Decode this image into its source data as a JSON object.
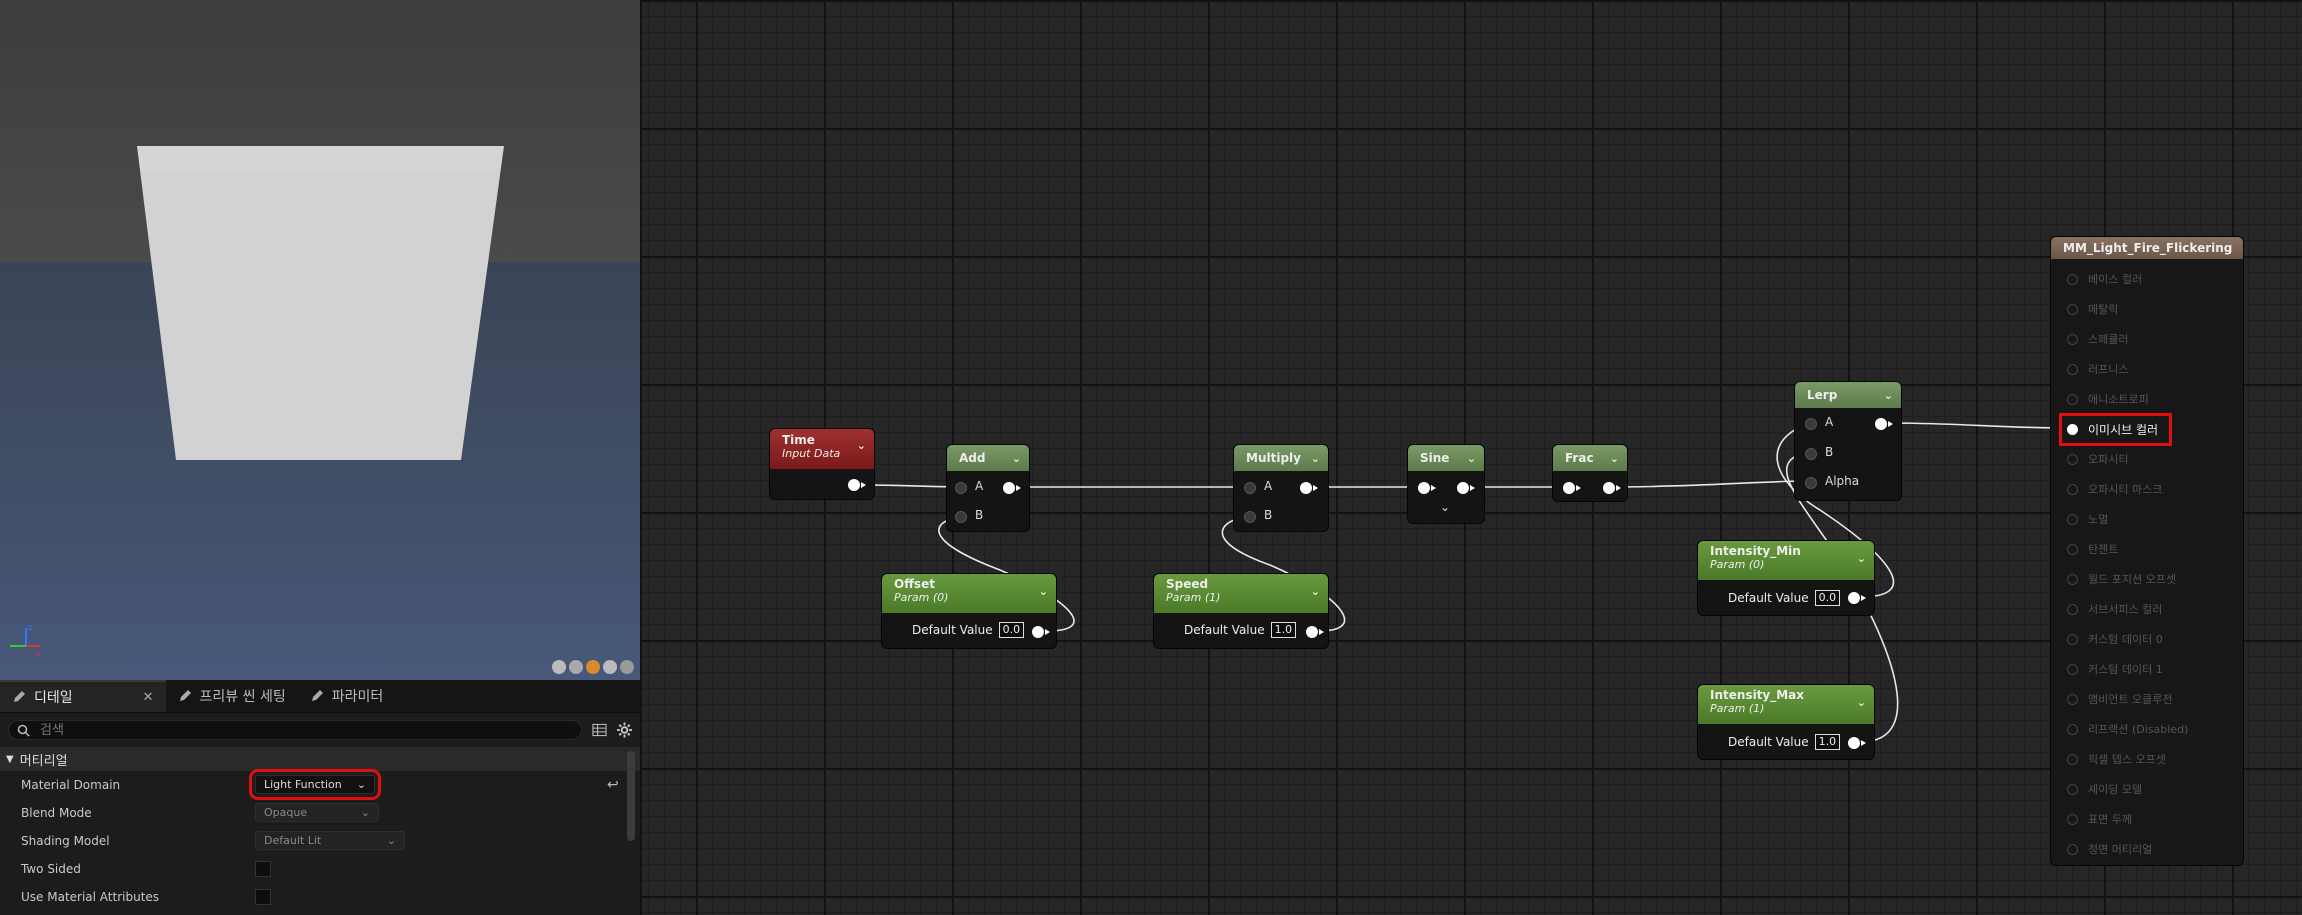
{
  "details": {
    "tabs": [
      {
        "label": "디테일",
        "active": true,
        "closable": true
      },
      {
        "label": "프리뷰 씬 세팅",
        "active": false
      },
      {
        "label": "파라미터",
        "active": false
      }
    ],
    "search_placeholder": "검색",
    "section": "머티리얼",
    "properties": [
      {
        "name": "Material Domain",
        "value": "Light Function",
        "kind": "dropdown",
        "highlighted": true
      },
      {
        "name": "Blend Mode",
        "value": "Opaque",
        "kind": "dropdown"
      },
      {
        "name": "Shading Model",
        "value": "Default Lit",
        "kind": "dropdown"
      },
      {
        "name": "Two Sided",
        "kind": "checkbox",
        "checked": false
      },
      {
        "name": "Use Material Attributes",
        "kind": "checkbox",
        "checked": false
      }
    ]
  },
  "graph": {
    "nodes": {
      "time": {
        "title": "Time",
        "subtitle": "Input Data"
      },
      "add": {
        "title": "Add",
        "in_a": "A",
        "in_b": "B"
      },
      "multiply": {
        "title": "Multiply",
        "in_a": "A",
        "in_b": "B"
      },
      "sine": {
        "title": "Sine"
      },
      "frac": {
        "title": "Frac"
      },
      "lerp": {
        "title": "Lerp",
        "in_a": "A",
        "in_b": "B",
        "in_alpha": "Alpha"
      },
      "offset": {
        "title": "Offset",
        "subtitle": "Param (0)",
        "dv_label": "Default Value",
        "dv": "0.0"
      },
      "speed": {
        "title": "Speed",
        "subtitle": "Param (1)",
        "dv_label": "Default Value",
        "dv": "1.0"
      },
      "intensity_min": {
        "title": "Intensity_Min",
        "subtitle": "Param (0)",
        "dv_label": "Default Value",
        "dv": "0.0"
      },
      "intensity_max": {
        "title": "Intensity_Max",
        "subtitle": "Param (1)",
        "dv_label": "Default Value",
        "dv": "1.0"
      }
    },
    "material_node": {
      "title": "MM_Light_Fire_Flickering",
      "inputs": [
        {
          "label": "베이스 컬러",
          "active": false
        },
        {
          "label": "메탈릭",
          "active": false
        },
        {
          "label": "스페큘러",
          "active": false
        },
        {
          "label": "러프니스",
          "active": false
        },
        {
          "label": "애니소트로피",
          "active": false
        },
        {
          "label": "이미시브 컬러",
          "active": true
        },
        {
          "label": "오파시티",
          "active": false
        },
        {
          "label": "오파시티 마스크",
          "active": false
        },
        {
          "label": "노멀",
          "active": false
        },
        {
          "label": "탄젠트",
          "active": false
        },
        {
          "label": "월드 포지션 오프셋",
          "active": false
        },
        {
          "label": "서브서피스 컬러",
          "active": false
        },
        {
          "label": "커스텀 데이터 0",
          "active": false
        },
        {
          "label": "커스텀 데이터 1",
          "active": false
        },
        {
          "label": "앰비언트 오클루전",
          "active": false
        },
        {
          "label": "리프랙션 (Disabled)",
          "active": false
        },
        {
          "label": "픽셀 뎁스 오프셋",
          "active": false
        },
        {
          "label": "셰이딩 모델",
          "active": false
        },
        {
          "label": "표면 두께",
          "active": false
        },
        {
          "label": "정면 머티리얼",
          "active": false
        }
      ]
    }
  }
}
